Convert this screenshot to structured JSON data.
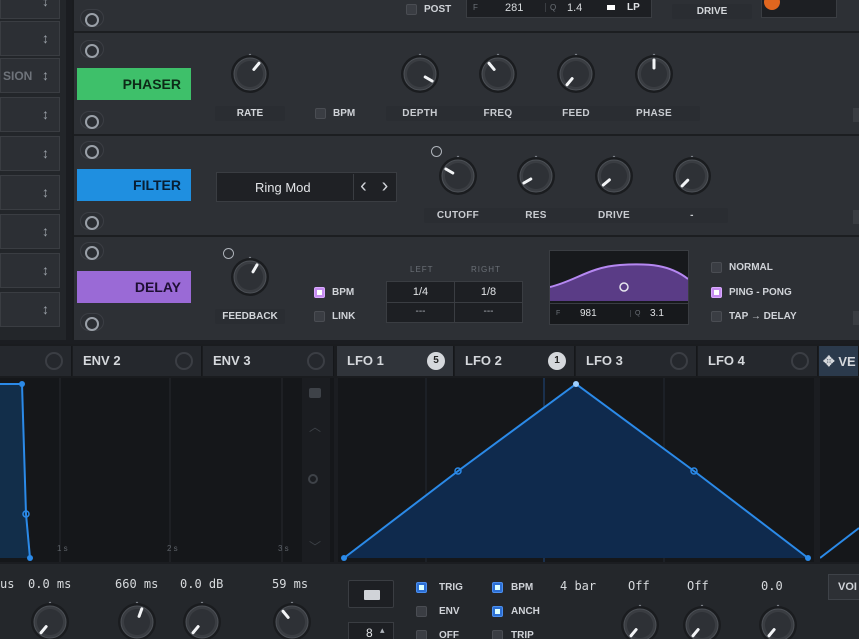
{
  "top_strip": {
    "post_label": "POST",
    "freq_prefix": "F",
    "freq_value": "281",
    "q_prefix": "Q",
    "q_value": "1.4",
    "mode": "LP",
    "drive_label": "DRIVE"
  },
  "sidebar": {
    "partial_label": "SION",
    "arrow_glyph": "↕"
  },
  "phaser": {
    "name": "PHASER",
    "color": "#3ec06a",
    "knobs": [
      "RATE",
      "DEPTH",
      "FREQ",
      "FEED",
      "PHASE"
    ],
    "bpm_label": "BPM"
  },
  "filter": {
    "name": "FILTER",
    "color": "#1f8fe0",
    "type_value": "Ring Mod",
    "prev_glyph": "‹",
    "next_glyph": "›",
    "knobs": [
      "CUTOFF",
      "RES",
      "DRIVE",
      "-"
    ]
  },
  "delay": {
    "name": "DELAY",
    "color": "#9a6ad6",
    "feedback_label": "FEEDBACK",
    "bpm_label": "BPM",
    "link_label": "LINK",
    "left_label": "LEFT",
    "right_label": "RIGHT",
    "left_value": "1/4",
    "right_value": "1/8",
    "left_sub": "---",
    "right_sub": "---",
    "f_prefix": "F",
    "f_value": "981",
    "q_prefix": "Q",
    "q_value": "3.1",
    "modes": [
      "NORMAL",
      "PING - PONG",
      "TAP → DELAY"
    ]
  },
  "tabs": [
    {
      "label": "ENV 2"
    },
    {
      "label": "ENV 3"
    },
    {
      "label": "LFO 1",
      "badge": "5"
    },
    {
      "label": "LFO 2",
      "badge": "1"
    },
    {
      "label": "LFO 3"
    },
    {
      "label": "LFO 4"
    },
    {
      "label": "VE"
    }
  ],
  "env_graph": {
    "ticks": [
      "1 s",
      "2 s",
      "3 s"
    ]
  },
  "bottom": {
    "env_values": [
      "us",
      "0.0 ms",
      "660 ms",
      "0.0 dB",
      "59 ms"
    ],
    "lfo_checks": [
      "TRIG",
      "ENV",
      "OFF"
    ],
    "lfo_checks2": [
      "BPM",
      "ANCH",
      "TRIP"
    ],
    "lfo_values": [
      "4 bar",
      "Off",
      "Off",
      "0.0"
    ],
    "stepper_value": "8",
    "voice_label": "VOI"
  }
}
